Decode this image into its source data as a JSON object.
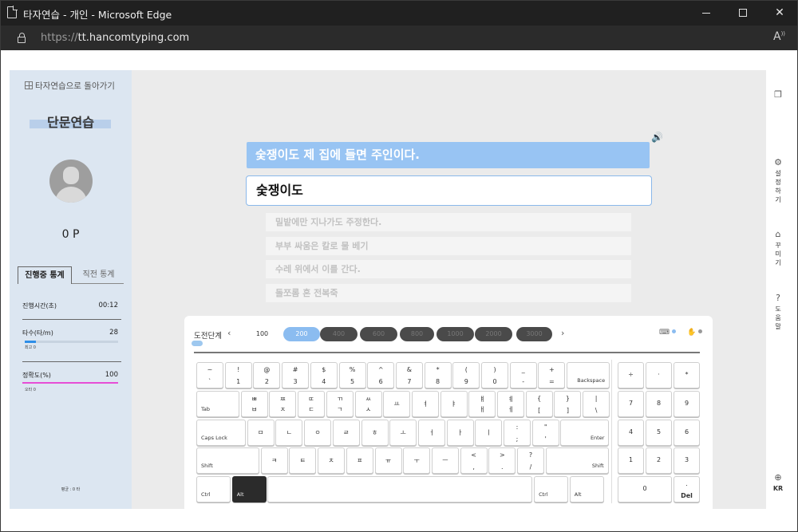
{
  "browser": {
    "tab_title": "타자연습 - 개인 - Microsoft Edge",
    "url_prefix": "https://",
    "url_domain": "tt.hancomtyping.com",
    "reader_icon": "A"
  },
  "sidebar": {
    "back_label": "타자연습으로 돌아가기",
    "mode_title": "단문연습",
    "points": "0 P",
    "tabs": [
      "진행중 통계",
      "직전 통계"
    ],
    "stats": {
      "time_label": "진행시간(초)",
      "time_value": "00:12",
      "speed_label": "타수(타/m)",
      "speed_value": "28",
      "speed_sub": "최고 0",
      "speed_fill": 0.12,
      "accuracy_label": "정확도(%)",
      "accuracy_value": "100",
      "accuracy_sub": "오타 0"
    },
    "footnote": "평균 : 0 타"
  },
  "practice": {
    "target_sentence": "숯쟁이도 제 집에 들면 주인이다.",
    "typed_text": "숯쟁이도",
    "upcoming": [
      "밀밭에만 지나가도 주정한다.",
      "부부 싸움은 칼로 물 베기",
      "수레 위에서 이를 간다.",
      "돌쪼롬 혼 전복죽"
    ]
  },
  "keyboard": {
    "level_label": "도전단계",
    "levels": [
      "100",
      "200",
      "400",
      "600",
      "800",
      "1000",
      "2000",
      "3000"
    ],
    "active_level": "200",
    "accent": "#8bbcf0",
    "rows": [
      [
        [
          "~",
          "`"
        ],
        [
          "!",
          "1"
        ],
        [
          "@",
          "2"
        ],
        [
          "#",
          "3"
        ],
        [
          "$",
          "4"
        ],
        [
          "%",
          "5"
        ],
        [
          "^",
          "6"
        ],
        [
          "&",
          "7"
        ],
        [
          "*",
          "8"
        ],
        [
          "(",
          "9"
        ],
        [
          ")",
          "0"
        ],
        [
          "_",
          "-"
        ],
        [
          "+",
          "="
        ],
        [
          "",
          "Backspace"
        ]
      ],
      [
        [
          "",
          "Tab"
        ],
        [
          "ㅃ",
          "ㅂ"
        ],
        [
          "ㅉ",
          "ㅈ"
        ],
        [
          "ㄸ",
          "ㄷ"
        ],
        [
          "ㄲ",
          "ㄱ"
        ],
        [
          "ㅆ",
          "ㅅ"
        ],
        [
          "",
          "ㅛ"
        ],
        [
          "",
          "ㅕ"
        ],
        [
          "",
          "ㅑ"
        ],
        [
          "ㅒ",
          "ㅐ"
        ],
        [
          "ㅖ",
          "ㅔ"
        ],
        [
          "{",
          "["
        ],
        [
          "}",
          "]"
        ],
        [
          "|",
          "\\"
        ]
      ],
      [
        [
          "",
          "Caps Lock"
        ],
        [
          "",
          "ㅁ"
        ],
        [
          "",
          "ㄴ"
        ],
        [
          "",
          "ㅇ"
        ],
        [
          "",
          "ㄹ"
        ],
        [
          "",
          "ㅎ"
        ],
        [
          "",
          "ㅗ"
        ],
        [
          "",
          "ㅓ"
        ],
        [
          "",
          "ㅏ"
        ],
        [
          "",
          "ㅣ"
        ],
        [
          ":",
          ";"
        ],
        [
          "\"",
          "'"
        ],
        [
          "",
          "Enter"
        ]
      ],
      [
        [
          "",
          "Shift"
        ],
        [
          "",
          "ㅋ"
        ],
        [
          "",
          "ㅌ"
        ],
        [
          "",
          "ㅊ"
        ],
        [
          "",
          "ㅍ"
        ],
        [
          "",
          "ㅠ"
        ],
        [
          "",
          "ㅜ"
        ],
        [
          "",
          "ㅡ"
        ],
        [
          "<",
          ","
        ],
        [
          ">",
          "."
        ],
        [
          "?",
          "/"
        ],
        [
          "",
          "Shift"
        ]
      ],
      [
        [
          "",
          "Ctrl"
        ],
        [
          "",
          "Alt"
        ],
        [
          "",
          ""
        ],
        [
          "",
          "Ctrl"
        ],
        [
          "",
          "Alt"
        ]
      ]
    ],
    "numpad": [
      [
        "÷",
        "·",
        "*"
      ],
      [
        "7",
        "8",
        "9"
      ],
      [
        "4",
        "5",
        "6"
      ],
      [
        "1",
        "2",
        "3"
      ],
      [
        "0",
        ".\nDel"
      ]
    ]
  },
  "right_rail": {
    "settings": "설정하기",
    "decorate": "꾸미기",
    "help": "도움말",
    "language": "KR"
  }
}
